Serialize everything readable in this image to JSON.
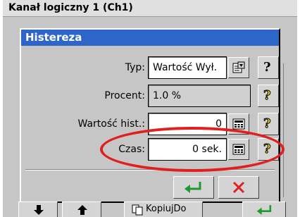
{
  "window": {
    "title": "Kanał logiczny 1 (Ch1)"
  },
  "dialog": {
    "title": "Histereza",
    "rows": [
      {
        "label": "Typ:",
        "value": "Wartość Wył.",
        "help": "?"
      },
      {
        "label": "Procent:",
        "value": "1.0 %",
        "help": "?"
      },
      {
        "label": "Wartość hist.:",
        "value": "0",
        "help": "?"
      },
      {
        "label": "Czas:",
        "value": "0 sek.",
        "help": "?"
      }
    ],
    "ok_icon": "enter-arrow-icon",
    "cancel_icon": "close-x-icon"
  },
  "toolbar": {
    "copy_label": "KopiujDo"
  },
  "colors": {
    "accent": "#2d66c8",
    "ok_green": "#1f9a2f",
    "cancel_red": "#e02020",
    "highlight": "#e02020",
    "help_yellow": "#e8d800"
  }
}
